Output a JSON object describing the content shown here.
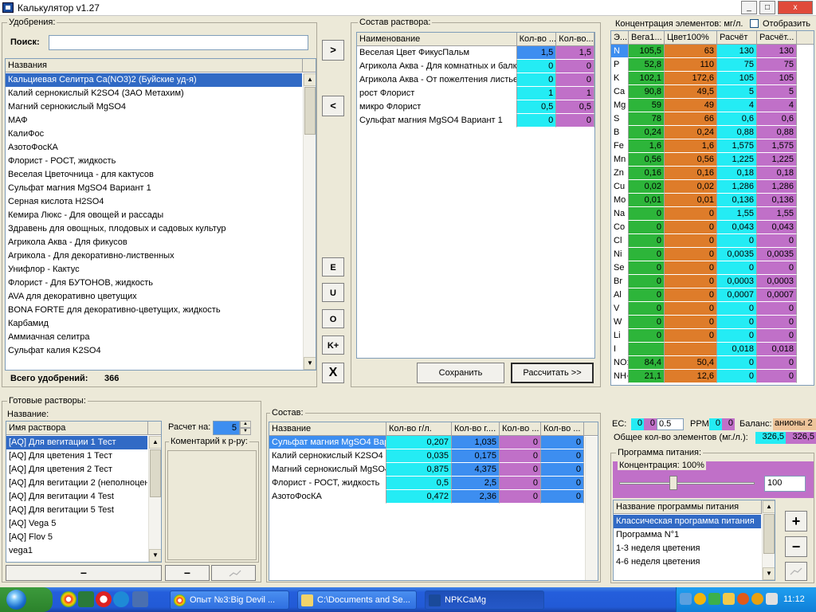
{
  "window": {
    "title": "Калькулятор v1.27",
    "min": "_",
    "max": "□",
    "close": "x"
  },
  "fert": {
    "group_title": "Удобрения:",
    "search_label": "Поиск:",
    "search_value": "",
    "list_header": "Названия",
    "items": [
      "Кальциевая Селитра Ca(NO3)2 (Буйские уд-я)",
      "Калий  сернокислый  K2SO4 (ЗАО Метахим)",
      "Магний сернокислый MgSO4",
      "МАФ",
      "КалиФос",
      "АзотоФосКА",
      "Флорист - РОСТ, жидкость",
      "Веселая Цветочница - для кактусов",
      "Сульфат магния MgSO4 Вариант 1",
      "Серная кислота H2SO4",
      "Кемира Люкс - Для овощей и рассады",
      "Здравень для овощных, плодовых и садовых культур",
      "Агрикола Аква - Для фикусов",
      "Агрикола - Для декоративно-лиственных",
      "Унифлор - Кактус",
      "Флорист - Для БУТОНОВ, жидкость",
      "AVA для декоративно цветущих",
      "BONA FORTE для декоративно-цветущих, жидкость",
      "Карбамид",
      "Аммиачная селитра",
      "Сульфат калия K2SO4"
    ],
    "total_label": "Всего удобрений:",
    "total_value": "366"
  },
  "mid_buttons": {
    "add": ">",
    "remove": "<",
    "e": "E",
    "u": "U",
    "o": "O",
    "k": "K+",
    "x": "X"
  },
  "solution": {
    "group_title": "Состав раствора:",
    "headers": [
      "Наименование",
      "Кол-во ...",
      "Кол-во..."
    ],
    "rows": [
      {
        "name": "Веселая Цвет ФикусПальм",
        "a": "1,5",
        "b": "1,5"
      },
      {
        "name": "Агрикола Аква - Для комнатных и балк",
        "a": "0",
        "b": "0"
      },
      {
        "name": "Агрикола Аква - От пожелтения листьев",
        "a": "0",
        "b": "0"
      },
      {
        "name": "рост Флорист",
        "a": "1",
        "b": "1"
      },
      {
        "name": "микро Флорист",
        "a": "0,5",
        "b": "0,5"
      },
      {
        "name": "Сульфат магния MgSO4 Вариант 1",
        "a": "0",
        "b": "0"
      }
    ],
    "save_label": "Сохранить",
    "calc_label": "Рассчитать >>"
  },
  "conc": {
    "title": "Концентрация элементов: мг/л.",
    "show_label": "Отобразить",
    "headers": [
      "Э...",
      "Вега1...",
      "Цвет100%",
      "Расчёт",
      "Расчёт..."
    ],
    "rows": [
      [
        "N",
        "105,5",
        "63",
        "130",
        "130"
      ],
      [
        "P",
        "52,8",
        "110",
        "75",
        "75"
      ],
      [
        "K",
        "102,1",
        "172,6",
        "105",
        "105"
      ],
      [
        "Ca",
        "90,8",
        "49,5",
        "5",
        "5"
      ],
      [
        "Mg",
        "59",
        "49",
        "4",
        "4"
      ],
      [
        "S",
        "78",
        "66",
        "0,6",
        "0,6"
      ],
      [
        "B",
        "0,24",
        "0,24",
        "0,88",
        "0,88"
      ],
      [
        "Fe",
        "1,6",
        "1,6",
        "1,575",
        "1,575"
      ],
      [
        "Mn",
        "0,56",
        "0,56",
        "1,225",
        "1,225"
      ],
      [
        "Zn",
        "0,16",
        "0,16",
        "0,18",
        "0,18"
      ],
      [
        "Cu",
        "0,02",
        "0,02",
        "1,286",
        "1,286"
      ],
      [
        "Mo",
        "0,01",
        "0,01",
        "0,136",
        "0,136"
      ],
      [
        "Na",
        "0",
        "0",
        "1,55",
        "1,55"
      ],
      [
        "Co",
        "0",
        "0",
        "0,043",
        "0,043"
      ],
      [
        "Cl",
        "0",
        "0",
        "0",
        "0"
      ],
      [
        "Ni",
        "0",
        "0",
        "0,0035",
        "0,0035"
      ],
      [
        "Se",
        "0",
        "0",
        "0",
        "0"
      ],
      [
        "Br",
        "0",
        "0",
        "0,0003",
        "0,0003"
      ],
      [
        "Al",
        "0",
        "0",
        "0,0007",
        "0,0007"
      ],
      [
        "V",
        "0",
        "0",
        "0",
        "0"
      ],
      [
        "W",
        "0",
        "0",
        "0",
        "0"
      ],
      [
        "Li",
        "0",
        "0",
        "0",
        "0"
      ],
      [
        "I",
        "",
        "",
        "0,018",
        "0,018"
      ],
      [
        "NO:",
        "84,4",
        "50,4",
        "0",
        "0"
      ],
      [
        "NH·",
        "21,1",
        "12,6",
        "0",
        "0"
      ]
    ],
    "ec_label": "EC:",
    "ec_a": "0",
    "ec_b": "0",
    "ec_spin": "0.5",
    "ppm_label": "PPM",
    "ppm_a": "0",
    "ppm_b": "0",
    "balance_label": "Баланс:",
    "balance_value": "анионы 2",
    "total_label": "Общее кол-во элементов (мг./л.):",
    "total_a": "326,5",
    "total_b": "326,5"
  },
  "ready": {
    "group_title": "Готовые растворы:",
    "name_label": "Название:",
    "header": "Имя раствора",
    "items": [
      "[AQ] Для вегитации 1 Тест",
      "[AQ] Для цветения 1 Тест",
      "[AQ] Для цветения 2 Тест",
      "[AQ] Для вегитации 2 (неполноцен",
      "[AQ] Для вегитации 4 Test",
      "[AQ] Для вегитации 5 Test",
      "[AQ] Vega 5",
      "[AQ] Flov 5",
      "vega1"
    ],
    "minus": "−",
    "calc_label": "Расчет на:",
    "calc_value": "5",
    "comment_label": "Коментарий к р-ру:"
  },
  "composition": {
    "group_title": "Состав:",
    "headers": [
      "Название",
      "Кол-во г/л.",
      "Кол-во г....",
      "Кол-во ...",
      "Кол-во ..."
    ],
    "rows": [
      [
        "Сульфат магния MgSO4 Вар",
        "0,207",
        "1,035",
        "0",
        "0"
      ],
      [
        "Калий  сернокислый  K2SO4",
        "0,035",
        "0,175",
        "0",
        "0"
      ],
      [
        "Магний сернокислый MgSO4",
        "0,875",
        "4,375",
        "0",
        "0"
      ],
      [
        "Флорист - РОСТ, жидкость",
        "0,5",
        "2,5",
        "0",
        "0"
      ],
      [
        "АзотоФосКА",
        "0,472",
        "2,36",
        "0",
        "0"
      ]
    ]
  },
  "program": {
    "group_title": "Программа питания:",
    "conc_label": "Концентрация: 100%",
    "slider_value": "100",
    "slider_fraction": 0.4,
    "list_header": "Название программы питания",
    "items": [
      "Классическая программа питания",
      "Программа N°1",
      "1-3 неделя цветения",
      "4-6 неделя цветения"
    ],
    "plus": "+",
    "minus": "−"
  },
  "taskbar": {
    "tasks": [
      "Опыт №3:Big Devil ...",
      "C:\\Documents and Se...",
      "NPKCaMg"
    ],
    "clock": "11:12"
  },
  "colors": {
    "green": "#2db53a",
    "orange": "#de7c2a",
    "cyan": "#24ecf4",
    "purple": "#c070c8",
    "selection": "#316ac5"
  }
}
